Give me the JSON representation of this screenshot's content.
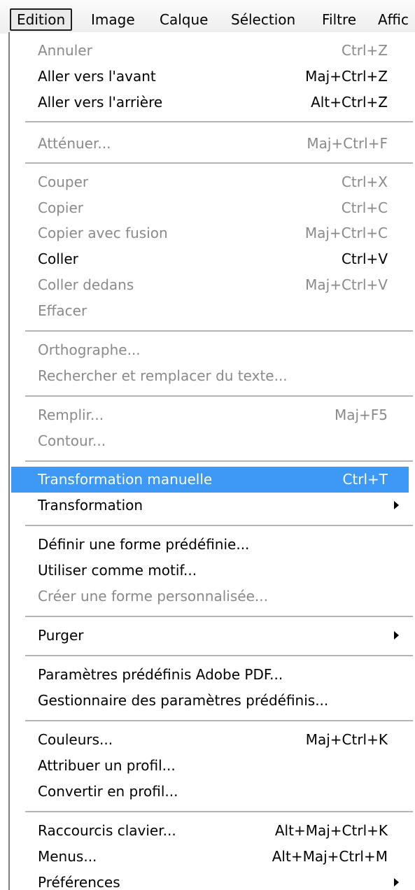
{
  "menubar": {
    "items": [
      "Edition",
      "Image",
      "Calque",
      "Sélection",
      "Filtre",
      "Affic"
    ]
  },
  "menu": {
    "items": [
      {
        "label": "Annuler",
        "shortcut": "Ctrl+Z",
        "enabled": false
      },
      {
        "label": "Aller vers l'avant",
        "shortcut": "Maj+Ctrl+Z",
        "enabled": true
      },
      {
        "label": "Aller vers l'arrière",
        "shortcut": "Alt+Ctrl+Z",
        "enabled": true
      },
      {
        "label": "Atténuer...",
        "shortcut": "Maj+Ctrl+F",
        "enabled": false
      },
      {
        "label": "Couper",
        "shortcut": "Ctrl+X",
        "enabled": false
      },
      {
        "label": "Copier",
        "shortcut": "Ctrl+C",
        "enabled": false
      },
      {
        "label": "Copier avec fusion",
        "shortcut": "Maj+Ctrl+C",
        "enabled": false
      },
      {
        "label": "Coller",
        "shortcut": "Ctrl+V",
        "enabled": true
      },
      {
        "label": "Coller dedans",
        "shortcut": "Maj+Ctrl+V",
        "enabled": false
      },
      {
        "label": "Effacer",
        "shortcut": "",
        "enabled": false
      },
      {
        "label": "Orthographe...",
        "shortcut": "",
        "enabled": false
      },
      {
        "label": "Rechercher et remplacer du texte...",
        "shortcut": "",
        "enabled": false
      },
      {
        "label": "Remplir...",
        "shortcut": "Maj+F5",
        "enabled": false
      },
      {
        "label": "Contour...",
        "shortcut": "",
        "enabled": false
      },
      {
        "label": "Transformation manuelle",
        "shortcut": "Ctrl+T",
        "enabled": true,
        "highlighted": true
      },
      {
        "label": "Transformation",
        "shortcut": "",
        "enabled": true,
        "submenu": true
      },
      {
        "label": "Définir une forme prédéfinie...",
        "shortcut": "",
        "enabled": true
      },
      {
        "label": "Utiliser comme motif...",
        "shortcut": "",
        "enabled": true
      },
      {
        "label": "Créer une forme personnalisée...",
        "shortcut": "",
        "enabled": false
      },
      {
        "label": "Purger",
        "shortcut": "",
        "enabled": true,
        "submenu": true
      },
      {
        "label": "Paramètres prédéfinis Adobe PDF...",
        "shortcut": "",
        "enabled": true
      },
      {
        "label": "Gestionnaire des paramètres prédéfinis...",
        "shortcut": "",
        "enabled": true
      },
      {
        "label": "Couleurs...",
        "shortcut": "Maj+Ctrl+K",
        "enabled": true
      },
      {
        "label": "Attribuer un profil...",
        "shortcut": "",
        "enabled": true
      },
      {
        "label": "Convertir en profil...",
        "shortcut": "",
        "enabled": true
      },
      {
        "label": "Raccourcis clavier...",
        "shortcut": "Alt+Maj+Ctrl+K",
        "enabled": true
      },
      {
        "label": "Menus...",
        "shortcut": "Alt+Maj+Ctrl+M",
        "enabled": true
      },
      {
        "label": "Préférences",
        "shortcut": "",
        "enabled": true,
        "submenu": true
      }
    ]
  },
  "colors": {
    "highlight": "#3d99f5",
    "disabled_text": "#8a8a8a",
    "separator": "#b5b5b5"
  }
}
